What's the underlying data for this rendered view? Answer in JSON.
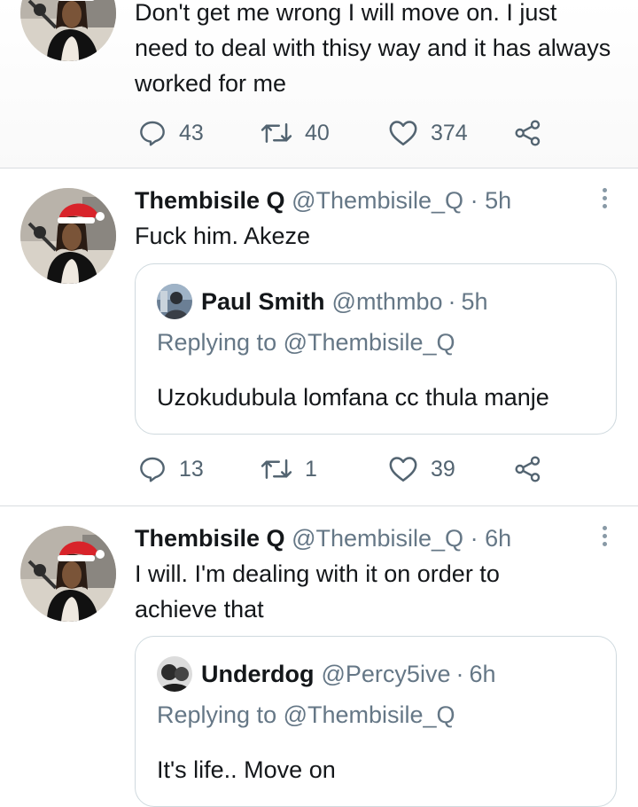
{
  "colors": {
    "text": "#14171a",
    "secondary": "#657786",
    "icon": "#536471",
    "border": "#cfd9de"
  },
  "tweets": [
    {
      "text": "Don't get me wrong I will move on. I just need to deal with thisy way and it has always worked for me",
      "replies": "43",
      "retweets": "40",
      "likes": "374"
    },
    {
      "name": "Thembisile Q",
      "handle": "@Thembisile_Q",
      "dot": "·",
      "time": "5h",
      "text": "Fuck him. Akeze",
      "quote": {
        "name": "Paul Smith",
        "handle": "@mthmbo",
        "dot": "·",
        "time": "5h",
        "replying_to": "Replying to @Thembisile_Q",
        "text": "Uzokudubula lomfana cc thula manje"
      },
      "replies": "13",
      "retweets": "1",
      "likes": "39"
    },
    {
      "name": "Thembisile Q",
      "handle": "@Thembisile_Q",
      "dot": "·",
      "time": "6h",
      "text": "I will. I'm dealing with it on order to achieve that",
      "quote": {
        "name": "Underdog",
        "handle": "@Percy5ive",
        "dot": "·",
        "time": "6h",
        "replying_to": "Replying to @Thembisile_Q",
        "text": "It's life.. Move on"
      }
    }
  ],
  "icons": {
    "reply": "reply-icon",
    "retweet": "retweet-icon",
    "like": "heart-icon",
    "share": "share-icon",
    "more": "more-vertical-icon"
  }
}
